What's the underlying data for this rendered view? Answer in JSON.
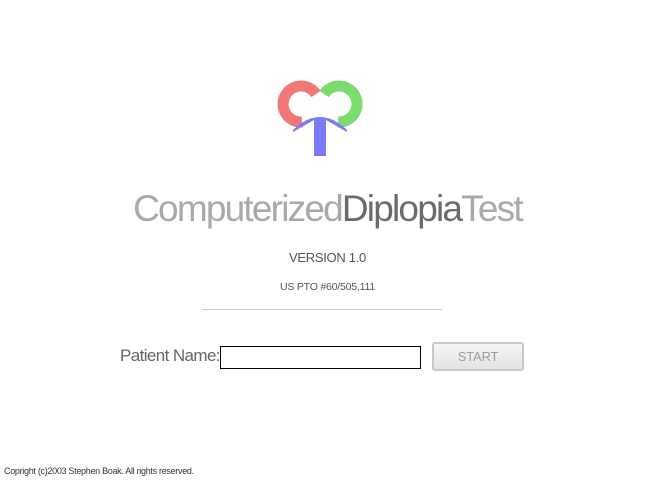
{
  "logo": {
    "icon": "diplopia-test-logo",
    "colors": {
      "left_loop": "#f27878",
      "right_loop": "#78dc6e",
      "stem": "#7a7aff"
    }
  },
  "title": {
    "part1": "Computerized",
    "part2": "Diplopia",
    "part3": "Test"
  },
  "version": "VERSION 1.0",
  "patent": "US PTO #60/505,111",
  "form": {
    "patient_label": "Patient Name:",
    "patient_value": "",
    "start_label": "START"
  },
  "footer": {
    "copyright": "Copright (c)2003 Stephen Boak.  All rights reserved."
  }
}
